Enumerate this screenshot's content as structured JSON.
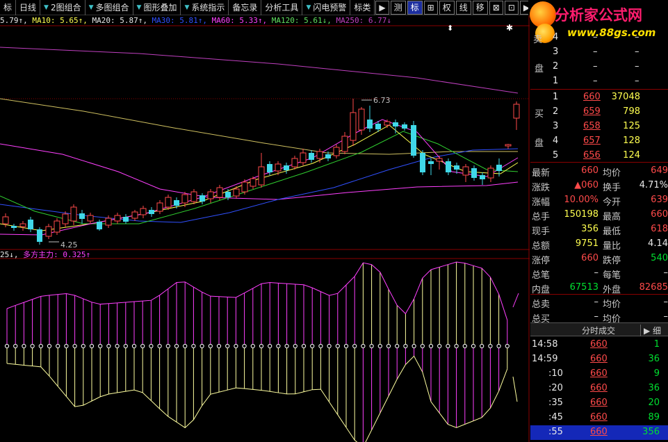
{
  "toolbar": {
    "items": [
      {
        "label": "标",
        "caret": false
      },
      {
        "label": "日线",
        "caret": false
      },
      {
        "label": "2图组合",
        "caret": true
      },
      {
        "label": "多图组合",
        "caret": true
      },
      {
        "label": "图形叠加",
        "caret": true
      },
      {
        "label": "系统指示",
        "caret": true
      },
      {
        "label": "备忘录",
        "caret": false
      },
      {
        "label": "分析工具",
        "caret": false
      },
      {
        "label": "闪电预警",
        "caret": true
      },
      {
        "label": "标类",
        "caret": false
      }
    ],
    "icons": [
      {
        "label": "▶",
        "name": "play-icon"
      },
      {
        "label": "测",
        "name": "measure-icon"
      },
      {
        "label": "标",
        "name": "mark-icon",
        "active": true
      },
      {
        "label": "⊞",
        "name": "grid-icon"
      },
      {
        "label": "权",
        "name": "rights-icon"
      },
      {
        "label": "线",
        "name": "line-icon"
      },
      {
        "label": "移",
        "name": "move-icon"
      },
      {
        "label": "⊠",
        "name": "box-icon"
      },
      {
        "label": "⊡",
        "name": "frame-icon"
      },
      {
        "label": "▶",
        "name": "next-icon"
      }
    ]
  },
  "logo": {
    "line1": "分析家公式网",
    "line2": "www.88gs.com"
  },
  "ma_line": [
    {
      "text": "5.79↑,",
      "color": "#e8e8e8"
    },
    {
      "text": " MA10: 5.65↑,",
      "color": "#ffff50"
    },
    {
      "text": " MA20: 5.87↑,",
      "color": "#e8e8e8"
    },
    {
      "text": " MA30: 5.81↑,",
      "color": "#3050ff"
    },
    {
      "text": " MA60: 5.33↑,",
      "color": "#ff40ff"
    },
    {
      "text": " MA120: 5.61↓,",
      "color": "#60e060"
    },
    {
      "text": " MA250: 6.77↓",
      "color": "#c040c0"
    }
  ],
  "ind_line": [
    {
      "text": "25↓,",
      "color": "#e8e8e8"
    },
    {
      "text": " 多方主力: 0.325↑",
      "color": "#ff40ff"
    }
  ],
  "chart_labels": {
    "high": "6.73",
    "low": "4.25"
  },
  "orderbook": {
    "sell_label_top": "卖",
    "sell_label_bottom": "盘",
    "sell": [
      {
        "n": "4",
        "price": "–",
        "vol": "–"
      },
      {
        "n": "3",
        "price": "–",
        "vol": "–"
      },
      {
        "n": "2",
        "price": "–",
        "vol": "–"
      },
      {
        "n": "1",
        "price": "–",
        "vol": "–"
      }
    ],
    "buy_label_top": "买",
    "buy_label_bottom": "盘",
    "buy": [
      {
        "n": "1",
        "price": "660",
        "vol": "37048"
      },
      {
        "n": "2",
        "price": "659",
        "vol": "798"
      },
      {
        "n": "3",
        "price": "658",
        "vol": "125"
      },
      {
        "n": "4",
        "price": "657",
        "vol": "128"
      },
      {
        "n": "5",
        "price": "656",
        "vol": "124"
      }
    ]
  },
  "stats": [
    {
      "l1": "最新",
      "v1": "660",
      "c1": "red",
      "l2": "均价",
      "v2": "649",
      "c2": "red"
    },
    {
      "l1": "涨跌",
      "v1": "▲060",
      "c1": "red",
      "l2": "换手",
      "v2": "4.71%",
      "c2": "white"
    },
    {
      "l1": "涨幅",
      "v1": "10.00%",
      "c1": "red",
      "l2": "今开",
      "v2": "639",
      "c2": "red"
    },
    {
      "l1": "总手",
      "v1": "150198",
      "c1": "yellow",
      "l2": "最高",
      "v2": "660",
      "c2": "red"
    },
    {
      "l1": "现手",
      "v1": "356",
      "c1": "yellow",
      "l2": "最低",
      "v2": "618",
      "c2": "red"
    },
    {
      "l1": "总额",
      "v1": "9751",
      "c1": "yellow",
      "l2": "量比",
      "v2": "4.14",
      "c2": "white"
    },
    {
      "l1": "涨停",
      "v1": "660",
      "c1": "red",
      "l2": "跌停",
      "v2": "540",
      "c2": "green"
    },
    {
      "l1": "总笔",
      "v1": "–",
      "c1": "white",
      "l2": "每笔",
      "v2": "–",
      "c2": "white"
    },
    {
      "l1": "内盘",
      "v1": "67513",
      "c1": "green",
      "l2": "外盘",
      "v2": "82685",
      "c2": "red"
    },
    {
      "l1": "总卖",
      "v1": "–",
      "c1": "white",
      "l2": "均价",
      "v2": "–",
      "c2": "white"
    },
    {
      "l1": "总买",
      "v1": "–",
      "c1": "white",
      "l2": "均价",
      "v2": "–",
      "c2": "white"
    }
  ],
  "ticks_header": {
    "label": "分时成交",
    "detail": "细"
  },
  "ticks": [
    {
      "t": "14:58",
      "p": "660",
      "v": "1"
    },
    {
      "t": "14:59",
      "p": "660",
      "v": "36"
    },
    {
      "t": ":10",
      "p": "660",
      "v": "9"
    },
    {
      "t": ":20",
      "p": "660",
      "v": "36"
    },
    {
      "t": ":35",
      "p": "660",
      "v": "20"
    },
    {
      "t": ":45",
      "p": "660",
      "v": "89"
    },
    {
      "t": ":55",
      "p": "660",
      "v": "356"
    }
  ],
  "colors": {
    "up": "#ff4a4a",
    "down": "#40d8e8",
    "grid": "#8a0000"
  }
}
